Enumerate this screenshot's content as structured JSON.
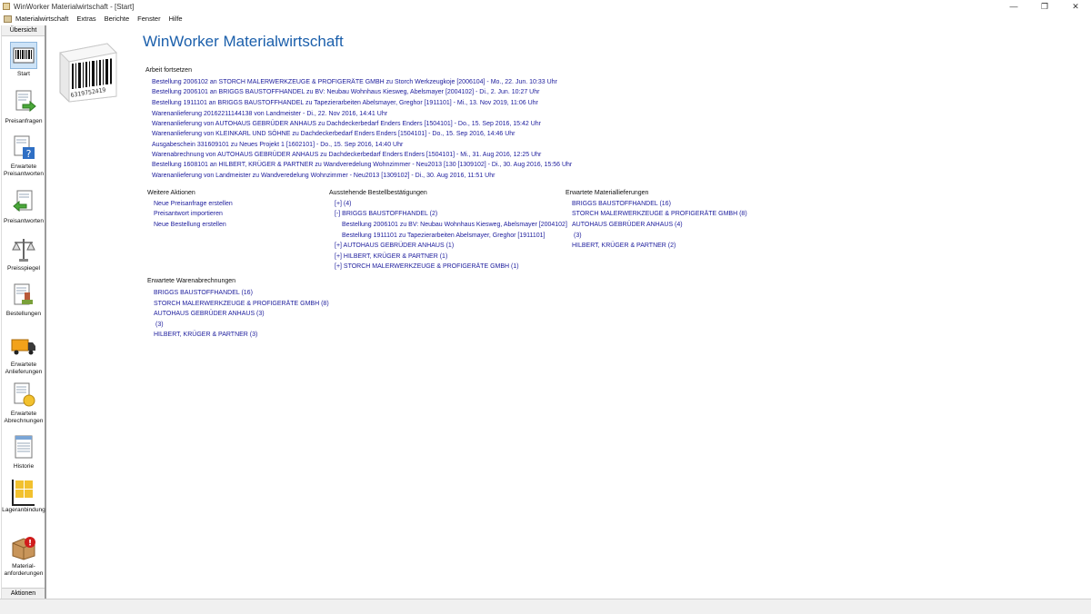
{
  "window": {
    "title": "WinWorker Materialwirtschaft - [Start]",
    "controls": [
      "—",
      "❐",
      "✕"
    ]
  },
  "menu": [
    "Materialwirtschaft",
    "Extras",
    "Berichte",
    "Fenster",
    "Hilfe"
  ],
  "sidebar": {
    "header": "Übersicht",
    "footer": "Aktionen",
    "items": [
      {
        "label": "Start",
        "icon": "barcode-icon"
      },
      {
        "label": "Preisanfragen",
        "icon": "document-arrow-icon"
      },
      {
        "label": "Erwartete Preisantworten",
        "icon": "document-question-icon"
      },
      {
        "label": "Preisantworten",
        "icon": "document-arrow-left-icon"
      },
      {
        "label": "Preisspiegel",
        "icon": "scales-icon"
      },
      {
        "label": "Bestellungen",
        "icon": "order-stamp-icon"
      },
      {
        "label": "Erwartete Anlieferungen",
        "icon": "truck-icon"
      },
      {
        "label": "Erwartete Abrechnungen",
        "icon": "invoice-coin-icon"
      },
      {
        "label": "Historie",
        "icon": "history-document-icon"
      },
      {
        "label": "Lageranbindung",
        "icon": "warehouse-shelf-icon"
      },
      {
        "label": "Material-anforderungen",
        "icon": "box-alert-icon"
      }
    ]
  },
  "logo": {
    "barcode_number": "6319752419"
  },
  "main": {
    "title": "WinWorker Materialwirtschaft",
    "continue_work": {
      "title": "Arbeit fortsetzen",
      "items": [
        "Bestellung 2006102 an STORCH MALERWERKZEUGE & PROFIGERÄTE GMBH zu Storch Werkzeugkoje [2006104] - Mo., 22. Jun. 10:33 Uhr",
        "Bestellung 2006101 an BRIGGS BAUSTOFFHANDEL zu BV: Neubau Wohnhaus Kiesweg, Abelsmayer [2004102] - Di., 2. Jun. 10:27 Uhr",
        "Bestellung 1911101 an BRIGGS BAUSTOFFHANDEL zu Tapezierarbeiten Abelsmayer, Greghor [1911101] - Mi., 13. Nov 2019, 11:06 Uhr",
        "Warenanlieferung 20162211144138 von Landmeister - Di., 22. Nov 2016, 14:41 Uhr",
        "Warenanlieferung von AUTOHAUS GEBRÜDER ANHAUS zu Dachdeckerbedarf Enders Enders [1504101] - Do., 15. Sep 2016, 15:42 Uhr",
        "Warenanlieferung von KLEINKARL UND SÖHNE zu Dachdeckerbedarf Enders Enders [1504101] - Do., 15. Sep 2016, 14:46 Uhr",
        "Ausgabeschein 331609101 zu Neues Projekt 1 [1602101] - Do., 15. Sep 2016, 14:40 Uhr",
        "Warenabrechnung von AUTOHAUS GEBRÜDER ANHAUS zu Dachdeckerbedarf Enders Enders [1504101] - Mi., 31. Aug 2016, 12:25 Uhr",
        "Bestellung 1608101 an HILBERT, KRÜGER & PARTNER zu Wandveredelung Wohnzimmer - Neu2013 [130 [1309102] - Di., 30. Aug 2016, 15:56 Uhr",
        "Warenanlieferung von Landmeister zu Wandveredelung Wohnzimmer - Neu2013 [1309102] - Di., 30. Aug 2016, 11:51 Uhr"
      ]
    },
    "more_actions": {
      "title": "Weitere Aktionen",
      "items": [
        "Neue Preisanfrage erstellen",
        "Preisantwort importieren",
        "Neue Bestellung erstellen"
      ]
    },
    "pending_confirmations": {
      "title": "Ausstehende Bestellbestätigungen",
      "items": [
        "[+]  (4)",
        "[-] BRIGGS BAUSTOFFHANDEL (2)",
        "Bestellung 2006101 zu BV: Neubau Wohnhaus Kiesweg, Abelsmayer [2004102]",
        "Bestellung 1911101 zu Tapezierarbeiten Abelsmayer, Greghor [1911101]",
        "[+] AUTOHAUS GEBRÜDER ANHAUS (1)",
        "[+] HILBERT, KRÜGER & PARTNER (1)",
        "[+] STORCH MALERWERKZEUGE & PROFIGERÄTE GMBH (1)"
      ]
    },
    "expected_deliveries": {
      "title": "Erwartete Materiallieferungen",
      "items": [
        "BRIGGS BAUSTOFFHANDEL (16)",
        "STORCH MALERWERKZEUGE & PROFIGERÄTE GMBH (8)",
        "AUTOHAUS GEBRÜDER ANHAUS (4)",
        "(3)",
        "HILBERT, KRÜGER & PARTNER (2)"
      ]
    },
    "expected_invoices": {
      "title": "Erwartete Warenabrechnungen",
      "items": [
        "BRIGGS BAUSTOFFHANDEL (16)",
        "STORCH MALERWERKZEUGE & PROFIGERÄTE GMBH (8)",
        "AUTOHAUS GEBRÜDER ANHAUS (3)",
        "(3)",
        "HILBERT, KRÜGER & PARTNER (3)"
      ]
    }
  },
  "colors": {
    "title_blue": "#1b5fab",
    "link_blue": "#1c1c9c"
  }
}
